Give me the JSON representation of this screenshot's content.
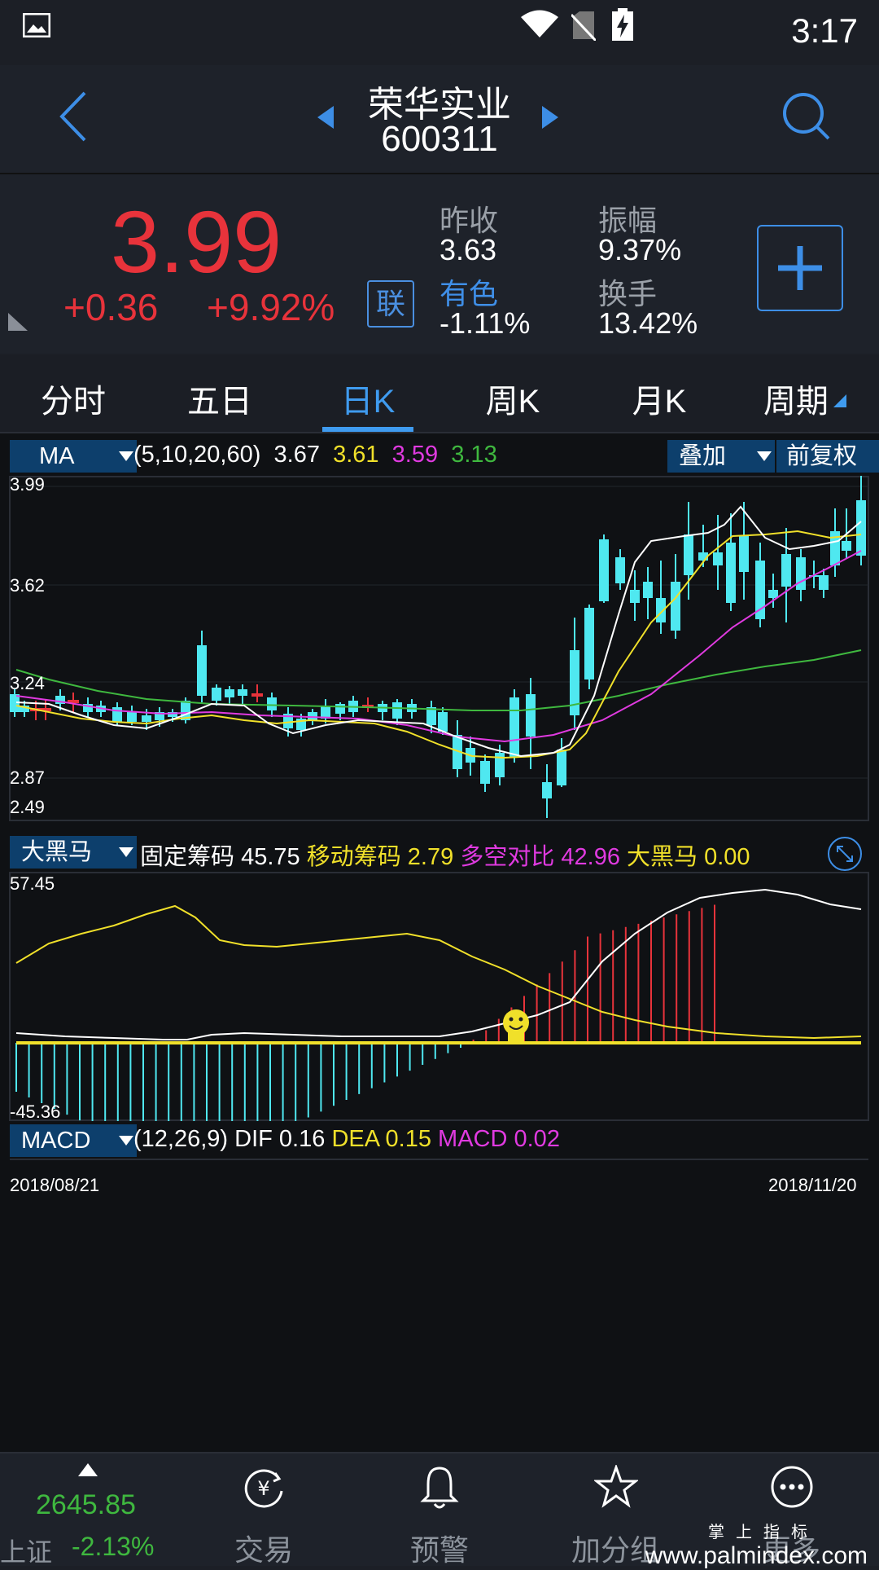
{
  "status_bar": {
    "time": "3:17",
    "icons": [
      "image-icon",
      "wifi-icon",
      "no-sim-icon",
      "battery-charging-icon"
    ]
  },
  "header": {
    "stock_name": "荣华实业",
    "stock_code": "600311"
  },
  "quote": {
    "price": "3.99",
    "change": "+0.36",
    "change_pct": "+9.92%",
    "badge": "联",
    "stats": [
      {
        "label": "昨收",
        "value": "3.63"
      },
      {
        "label": "振幅",
        "value": "9.37%"
      },
      {
        "label": "有色",
        "value": "-1.11%"
      },
      {
        "label": "换手",
        "value": "13.42%"
      }
    ]
  },
  "tabs": [
    "分时",
    "五日",
    "日K",
    "周K",
    "月K",
    "周期"
  ],
  "active_tab": "日K",
  "main_chart": {
    "indicator": "MA",
    "params": "(5,10,20,60)",
    "values": [
      "3.67",
      "3.61",
      "3.59",
      "3.13"
    ],
    "overlay_btn": "叠加",
    "adjust_btn": "前复权",
    "y_ticks": [
      "3.99",
      "3.62",
      "3.24",
      "2.87",
      "2.49"
    ],
    "colors": {
      "ma5": "#ffffff",
      "ma10": "#f0e02a",
      "ma20": "#e03ae0",
      "ma60": "#3fb83f",
      "up": "#e8333b",
      "down": "#4fe8f0"
    }
  },
  "sub_chart": {
    "indicator": "大黑马",
    "items": [
      {
        "label": "固定筹码",
        "value": "45.75",
        "color": "#ffffff"
      },
      {
        "label": "移动筹码",
        "value": "2.79",
        "color": "#f0e02a"
      },
      {
        "label": "多空对比",
        "value": "42.96",
        "color": "#e03ae0"
      },
      {
        "label": "大黑马",
        "value": "0.00",
        "color": "#f0e02a"
      }
    ],
    "y_top": "57.45",
    "y_bottom": "-45.36"
  },
  "macd": {
    "indicator": "MACD",
    "params": "(12,26,9)",
    "dif_label": "DIF",
    "dif": "0.16",
    "dea_label": "DEA",
    "dea": "0.15",
    "macd_label": "MACD",
    "macd": "0.02"
  },
  "date_range": {
    "start": "2018/08/21",
    "end": "2018/11/20"
  },
  "bottom_bar": {
    "index_value": "2645.85",
    "index_name": "上证",
    "index_change": "-2.13%",
    "items": [
      "交易",
      "预警",
      "加分组",
      "更多"
    ]
  },
  "watermark": {
    "top": "掌上指标",
    "url": "www.palmindex.com"
  }
}
